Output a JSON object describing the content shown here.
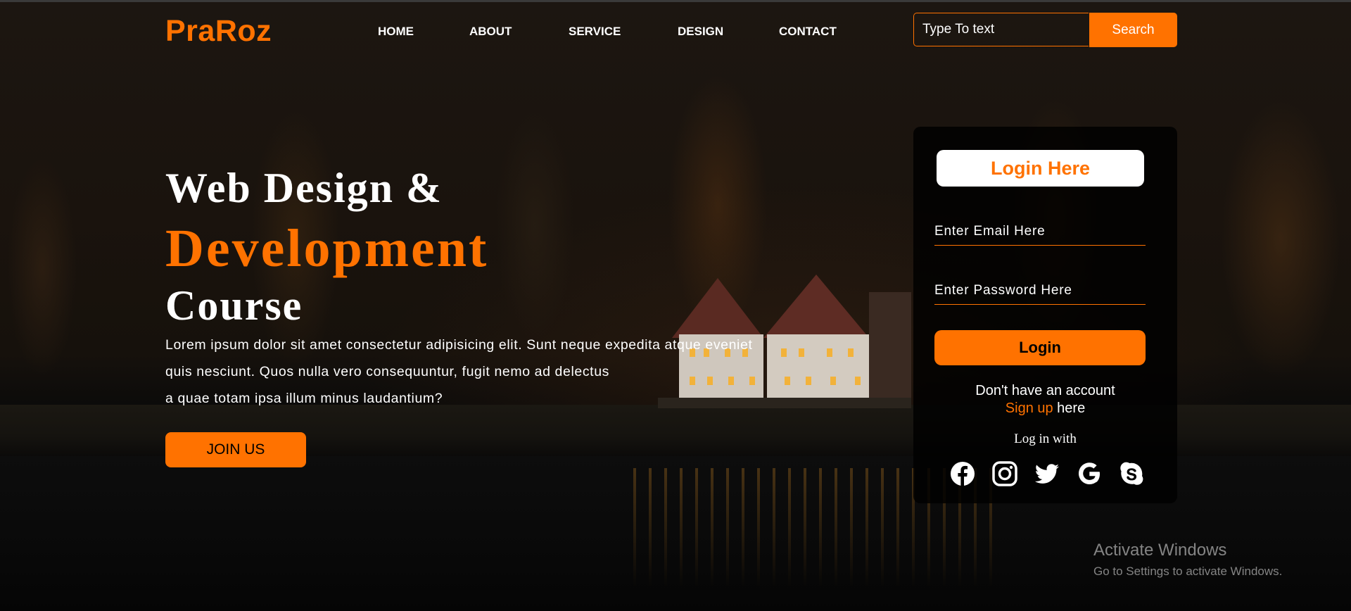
{
  "brand": {
    "logo": "PraRoz",
    "accent": "#ff7200"
  },
  "nav": {
    "items": [
      {
        "label": "HOME"
      },
      {
        "label": "ABOUT"
      },
      {
        "label": "SERVICE"
      },
      {
        "label": "DESIGN"
      },
      {
        "label": "CONTACT"
      }
    ]
  },
  "search": {
    "placeholder": "Type To text",
    "button_label": "Search"
  },
  "hero": {
    "title_line1": "Web Design &",
    "title_line2": "Development",
    "title_line3": "Course",
    "paragraph_lines": [
      "Lorem ipsum dolor sit amet consectetur adipisicing elit. Sunt neque expedita atque eveniet",
      "quis nesciunt. Quos nulla vero consequuntur, fugit nemo ad delectus",
      "a quae totam ipsa illum minus laudantium?"
    ],
    "join_label": "JOIN US"
  },
  "login": {
    "title": "Login Here",
    "email_placeholder": "Enter Email Here",
    "password_placeholder": "Enter Password Here",
    "button_label": "Login",
    "no_account_text": "Don't have an account",
    "signup_link": "Sign up",
    "signup_suffix": " here",
    "log_in_with": "Log in with",
    "social_icons": [
      "facebook-icon",
      "instagram-icon",
      "twitter-icon",
      "google-icon",
      "skype-icon"
    ]
  },
  "watermark": {
    "title": "Activate Windows",
    "subtitle": "Go to Settings to activate Windows."
  }
}
